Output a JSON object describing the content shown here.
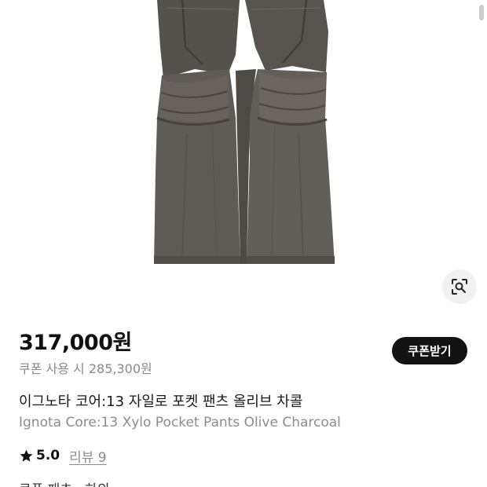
{
  "product": {
    "image_alt": "Olive charcoal cargo pocket pants",
    "price": "317,000원",
    "coupon_price": "쿠폰 사용 시 285,300원",
    "coupon_button_label": "쿠폰받기",
    "title_ko": "이그노타 코어:13 자일로 포켓 팬츠 올리브 차콜",
    "title_en": "Ignota Core:13 Xylo Pocket Pants Olive Charcoal",
    "rating": "5.0",
    "review_link": "리뷰 9",
    "partial_line": "쿠폰 패츠 · 하의"
  },
  "icons": {
    "lens": "image-search-icon",
    "star": "star-icon"
  },
  "colors": {
    "pants_fabric": "#5c5853",
    "pants_shadow": "#4a4642",
    "coupon_button_bg": "#121212",
    "price_text": "#111111",
    "secondary_text": "#8c8c8c",
    "lens_button_bg": "#f1f1f1"
  }
}
